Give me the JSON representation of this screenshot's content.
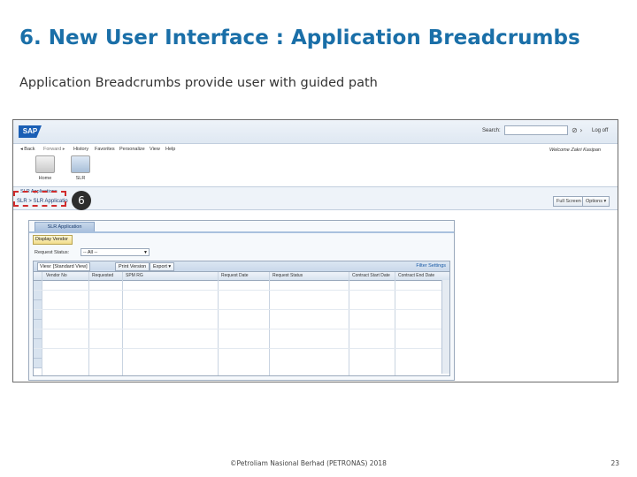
{
  "slide": {
    "title": "6. New User Interface : Application Breadcrumbs",
    "subtitle": "Application Breadcrumbs provide user with guided path",
    "footer": "©Petroliam Nasional Berhad (PETRONAS) 2018",
    "page_number": "23",
    "title_color": "#1a6fa8"
  },
  "sap": {
    "logo": "SAP",
    "search_label": "Search:",
    "search_go_icon": "magnifier-icon",
    "log_off": "Log off",
    "welcome": "Welcome Zakri Kasipan",
    "nav": [
      "◂ Back",
      "Forward ▸",
      "History",
      "Favorites",
      "Personalize",
      "View",
      "Help"
    ],
    "launch": [
      {
        "label": "Home",
        "icon": "home-icon"
      },
      {
        "label": "SLR",
        "icon": "slr-icon"
      }
    ],
    "breadcrumb_title": "SLR Applications",
    "breadcrumb_path": "SLR > SLR Applicatio",
    "callout_number": "6",
    "full_screen": "Full Screen",
    "options": "Options ▾",
    "app_tab": "SLR Application",
    "display_btn": "Display Vendor",
    "status_label": "Request Status:",
    "status_value": "-- All --",
    "view_label": "View: [Standard View]",
    "print_version": "Print Version",
    "export": "Export ▾",
    "filter_settings": "Filter Settings",
    "columns": [
      "Vendor No",
      "Requested",
      "SPM RG",
      "Request Date",
      "Request Status",
      "Contract Start Date",
      "Contract End Date"
    ]
  }
}
